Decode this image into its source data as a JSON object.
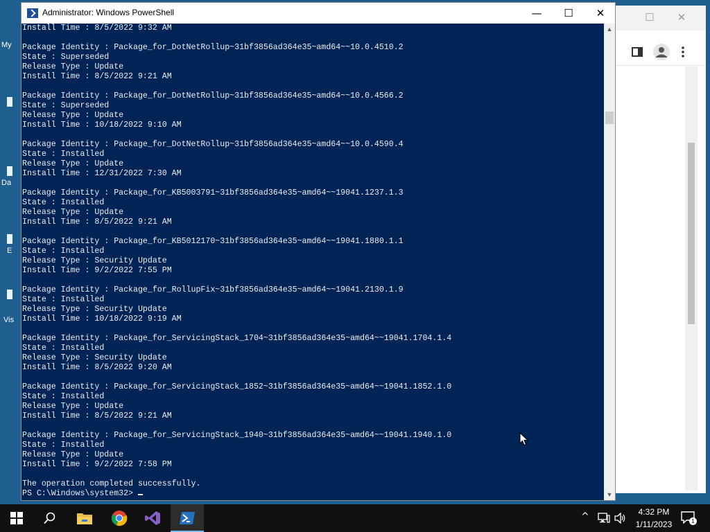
{
  "desktop": {
    "icon_labels": [
      "My",
      "Da",
      "E",
      "Vis"
    ]
  },
  "background_window": {
    "controls": [
      "☐",
      "✕"
    ]
  },
  "powershell": {
    "title": "Administrator: Windows PowerShell",
    "controls": {
      "minimize": "—",
      "maximize": "☐",
      "close": "✕"
    },
    "lines": [
      "Install Time : 8/5/2022 9:32 AM",
      "",
      "Package Identity : Package_for_DotNetRollup~31bf3856ad364e35~amd64~~10.0.4510.2",
      "State : Superseded",
      "Release Type : Update",
      "Install Time : 8/5/2022 9:21 AM",
      "",
      "Package Identity : Package_for_DotNetRollup~31bf3856ad364e35~amd64~~10.0.4566.2",
      "State : Superseded",
      "Release Type : Update",
      "Install Time : 10/18/2022 9:10 AM",
      "",
      "Package Identity : Package_for_DotNetRollup~31bf3856ad364e35~amd64~~10.0.4590.4",
      "State : Installed",
      "Release Type : Update",
      "Install Time : 12/31/2022 7:30 AM",
      "",
      "Package Identity : Package_for_KB5003791~31bf3856ad364e35~amd64~~19041.1237.1.3",
      "State : Installed",
      "Release Type : Update",
      "Install Time : 8/5/2022 9:21 AM",
      "",
      "Package Identity : Package_for_KB5012170~31bf3856ad364e35~amd64~~19041.1880.1.1",
      "State : Installed",
      "Release Type : Security Update",
      "Install Time : 9/2/2022 7:55 PM",
      "",
      "Package Identity : Package_for_RollupFix~31bf3856ad364e35~amd64~~19041.2130.1.9",
      "State : Installed",
      "Release Type : Security Update",
      "Install Time : 10/18/2022 9:19 AM",
      "",
      "Package Identity : Package_for_ServicingStack_1704~31bf3856ad364e35~amd64~~19041.1704.1.4",
      "State : Installed",
      "Release Type : Security Update",
      "Install Time : 8/5/2022 9:20 AM",
      "",
      "Package Identity : Package_for_ServicingStack_1852~31bf3856ad364e35~amd64~~19041.1852.1.0",
      "State : Installed",
      "Release Type : Update",
      "Install Time : 8/5/2022 9:21 AM",
      "",
      "Package Identity : Package_for_ServicingStack_1940~31bf3856ad364e35~amd64~~19041.1940.1.0",
      "State : Installed",
      "Release Type : Update",
      "Install Time : 9/2/2022 7:58 PM",
      "",
      "The operation completed successfully.",
      "PS C:\\Windows\\system32> "
    ]
  },
  "taskbar": {
    "clock_time": "4:32 PM",
    "clock_date": "1/11/2023",
    "notification_count": "1",
    "apps": [
      "start-button",
      "search",
      "file-explorer",
      "chrome",
      "visual-studio",
      "powershell"
    ]
  },
  "colors": {
    "console_bg": "#012456",
    "console_fg": "#eeedf0",
    "taskbar_bg": "#101010",
    "desktop_bg": "#1f5f8f"
  }
}
